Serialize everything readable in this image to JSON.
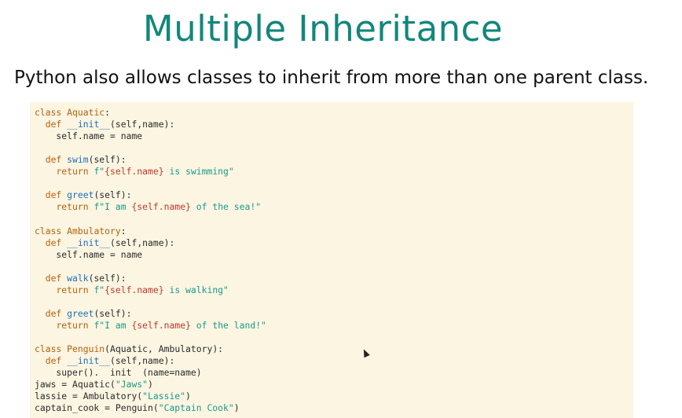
{
  "slide": {
    "title": "Multiple Inheritance",
    "subtitle": "Python also allows classes to inherit from more than one parent class."
  },
  "code": {
    "lines": [
      [
        [
          "kw",
          "class "
        ],
        [
          "cls",
          "Aquatic"
        ],
        [
          "p",
          ":"
        ]
      ],
      [
        [
          "p",
          "  "
        ],
        [
          "kw",
          "def "
        ],
        [
          "fn",
          "__init__"
        ],
        [
          "p",
          "(self,name):"
        ]
      ],
      [
        [
          "p",
          "    self.name = name"
        ]
      ],
      [],
      [
        [
          "p",
          "  "
        ],
        [
          "kw",
          "def "
        ],
        [
          "fn",
          "swim"
        ],
        [
          "p",
          "(self):"
        ]
      ],
      [
        [
          "p",
          "    "
        ],
        [
          "kw",
          "return "
        ],
        [
          "str",
          "f\""
        ],
        [
          "interp",
          "{self.name}"
        ],
        [
          "str",
          " is swimming\""
        ]
      ],
      [],
      [
        [
          "p",
          "  "
        ],
        [
          "kw",
          "def "
        ],
        [
          "fn",
          "greet"
        ],
        [
          "p",
          "(self):"
        ]
      ],
      [
        [
          "p",
          "    "
        ],
        [
          "kw",
          "return "
        ],
        [
          "str",
          "f\"I am "
        ],
        [
          "interp",
          "{self.name}"
        ],
        [
          "str",
          " of the sea!\""
        ]
      ],
      [],
      [
        [
          "kw",
          "class "
        ],
        [
          "cls",
          "Ambulatory"
        ],
        [
          "p",
          ":"
        ]
      ],
      [
        [
          "p",
          "  "
        ],
        [
          "kw",
          "def "
        ],
        [
          "fn",
          "__init__"
        ],
        [
          "p",
          "(self,name):"
        ]
      ],
      [
        [
          "p",
          "    self.name = name"
        ]
      ],
      [],
      [
        [
          "p",
          "  "
        ],
        [
          "kw",
          "def "
        ],
        [
          "fn",
          "walk"
        ],
        [
          "p",
          "(self):"
        ]
      ],
      [
        [
          "p",
          "    "
        ],
        [
          "kw",
          "return "
        ],
        [
          "str",
          "f\""
        ],
        [
          "interp",
          "{self.name}"
        ],
        [
          "str",
          " is walking\""
        ]
      ],
      [],
      [
        [
          "p",
          "  "
        ],
        [
          "kw",
          "def "
        ],
        [
          "fn",
          "greet"
        ],
        [
          "p",
          "(self):"
        ]
      ],
      [
        [
          "p",
          "    "
        ],
        [
          "kw",
          "return "
        ],
        [
          "str",
          "f\"I am "
        ],
        [
          "interp",
          "{self.name}"
        ],
        [
          "str",
          " of the land!\""
        ]
      ],
      [],
      [
        [
          "kw",
          "class "
        ],
        [
          "cls",
          "Penguin"
        ],
        [
          "p",
          "(Aquatic, Ambulatory):"
        ]
      ],
      [
        [
          "p",
          "  "
        ],
        [
          "kw",
          "def "
        ],
        [
          "fn",
          "__init__"
        ],
        [
          "p",
          "(self,name):"
        ]
      ],
      [
        [
          "p",
          "    super().  init  (name=name)"
        ]
      ],
      [
        [
          "p",
          "jaws = Aquatic("
        ],
        [
          "str",
          "\"Jaws\""
        ],
        [
          "p",
          ")"
        ]
      ],
      [
        [
          "p",
          "lassie = Ambulatory("
        ],
        [
          "str",
          "\"Lassie\""
        ],
        [
          "p",
          ")"
        ]
      ],
      [
        [
          "p",
          "captain_cook = Penguin("
        ],
        [
          "str",
          "\"Captain Cook\""
        ],
        [
          "p",
          ")"
        ]
      ]
    ]
  }
}
